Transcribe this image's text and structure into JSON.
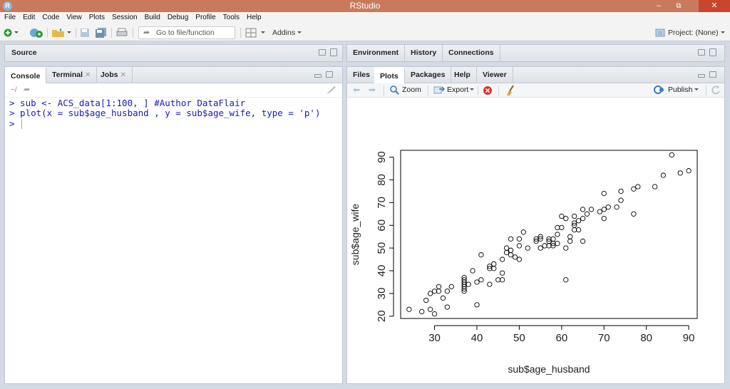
{
  "window": {
    "title": "RStudio",
    "app_icon": "R"
  },
  "menubar": [
    "File",
    "Edit",
    "Code",
    "View",
    "Plots",
    "Session",
    "Build",
    "Debug",
    "Profile",
    "Tools",
    "Help"
  ],
  "toolbar": {
    "goto_placeholder": "Go to file/function",
    "addins_label": "Addins",
    "project_label": "Project: (None)"
  },
  "source_pane": {
    "title": "Source"
  },
  "console_pane": {
    "tabs": [
      "Console",
      "Terminal",
      "Jobs"
    ],
    "path": "~/",
    "lines": [
      "> sub <- ACS_data[1:100, ] #Author DataFlair",
      "> plot(x = sub$age_husband , y = sub$age_wife, type = 'p')",
      "> "
    ]
  },
  "env_pane": {
    "tabs": [
      "Environment",
      "History",
      "Connections"
    ]
  },
  "files_pane": {
    "tabs": [
      "Files",
      "Plots",
      "Packages",
      "Help",
      "Viewer"
    ],
    "active_tab": "Plots",
    "zoom_label": "Zoom",
    "export_label": "Export",
    "publish_label": "Publish"
  },
  "colors": {
    "titlebar": "#c97a5c",
    "console_text": "#1a1ab8"
  },
  "chart_data": {
    "type": "scatter",
    "xlabel": "sub$age_husband",
    "ylabel": "sub$age_wife",
    "xlim": [
      22,
      92
    ],
    "ylim": [
      19,
      93
    ],
    "xticks": [
      30,
      40,
      50,
      60,
      70,
      80,
      90
    ],
    "yticks": [
      20,
      30,
      40,
      50,
      60,
      70,
      80,
      90
    ],
    "points": [
      [
        24,
        23
      ],
      [
        27,
        22
      ],
      [
        28,
        27
      ],
      [
        29,
        23
      ],
      [
        29,
        30
      ],
      [
        30,
        21
      ],
      [
        30,
        31
      ],
      [
        31,
        31
      ],
      [
        31,
        33
      ],
      [
        32,
        28
      ],
      [
        33,
        24
      ],
      [
        33,
        31
      ],
      [
        34,
        33
      ],
      [
        37,
        31
      ],
      [
        37,
        32
      ],
      [
        37,
        33
      ],
      [
        37,
        34
      ],
      [
        37,
        35
      ],
      [
        37,
        36
      ],
      [
        37,
        37
      ],
      [
        38,
        34
      ],
      [
        39,
        40
      ],
      [
        40,
        25
      ],
      [
        40,
        35
      ],
      [
        41,
        47
      ],
      [
        41,
        36
      ],
      [
        43,
        34
      ],
      [
        43,
        41
      ],
      [
        43,
        42
      ],
      [
        44,
        41
      ],
      [
        44,
        43
      ],
      [
        45,
        36
      ],
      [
        46,
        39
      ],
      [
        46,
        45
      ],
      [
        46,
        36
      ],
      [
        47,
        48
      ],
      [
        47,
        50
      ],
      [
        48,
        49
      ],
      [
        48,
        54
      ],
      [
        48,
        47
      ],
      [
        49,
        46
      ],
      [
        50,
        45
      ],
      [
        50,
        51
      ],
      [
        50,
        54
      ],
      [
        51,
        57
      ],
      [
        52,
        50
      ],
      [
        54,
        53
      ],
      [
        54,
        54
      ],
      [
        55,
        54
      ],
      [
        55,
        55
      ],
      [
        55,
        50
      ],
      [
        56,
        51
      ],
      [
        57,
        51
      ],
      [
        57,
        54
      ],
      [
        57,
        53
      ],
      [
        58,
        51
      ],
      [
        58,
        52
      ],
      [
        58,
        54
      ],
      [
        59,
        52
      ],
      [
        59,
        56
      ],
      [
        59,
        59
      ],
      [
        60,
        64
      ],
      [
        60,
        59
      ],
      [
        61,
        50
      ],
      [
        61,
        36
      ],
      [
        61,
        63
      ],
      [
        62,
        53
      ],
      [
        62,
        55
      ],
      [
        63,
        58
      ],
      [
        63,
        60
      ],
      [
        63,
        61
      ],
      [
        63,
        64
      ],
      [
        64,
        58
      ],
      [
        64,
        62
      ],
      [
        65,
        53
      ],
      [
        65,
        63
      ],
      [
        65,
        67
      ],
      [
        66,
        65
      ],
      [
        67,
        67
      ],
      [
        69,
        66
      ],
      [
        70,
        67
      ],
      [
        70,
        63
      ],
      [
        70,
        74
      ],
      [
        71,
        68
      ],
      [
        73,
        68
      ],
      [
        74,
        71
      ],
      [
        74,
        75
      ],
      [
        77,
        65
      ],
      [
        77,
        76
      ],
      [
        78,
        77
      ],
      [
        82,
        77
      ],
      [
        84,
        82
      ],
      [
        86,
        91
      ],
      [
        88,
        83
      ],
      [
        90,
        84
      ]
    ]
  }
}
